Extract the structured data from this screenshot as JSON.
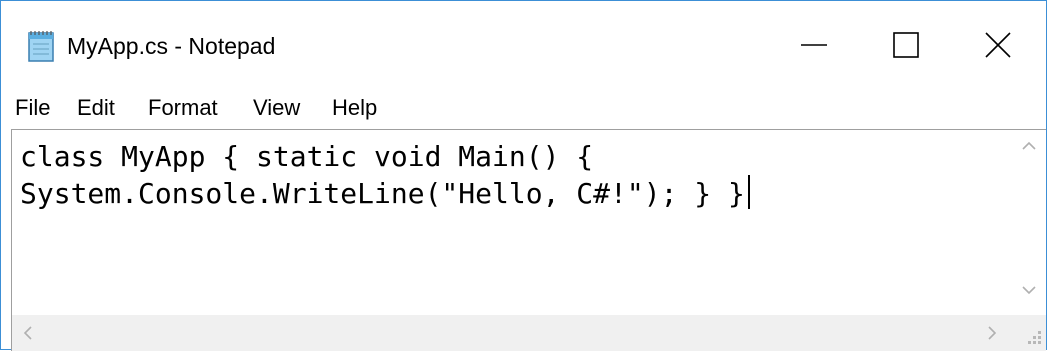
{
  "window": {
    "title": "MyApp.cs - Notepad",
    "icon": "notepad-icon",
    "controls": [
      "minimize-icon",
      "maximize-icon",
      "close-icon"
    ]
  },
  "menu": {
    "file": "File",
    "edit": "Edit",
    "format": "Format",
    "view": "View",
    "help": "Help"
  },
  "editor": {
    "lines": [
      "class MyApp { static void Main() {",
      "System.Console.WriteLine(\"Hello, C#!\"); } }"
    ]
  },
  "colors": {
    "window_border": "#3c8fd6",
    "scrollbar_track": "#f0f0f0",
    "arrow": "#b0b0b0"
  }
}
